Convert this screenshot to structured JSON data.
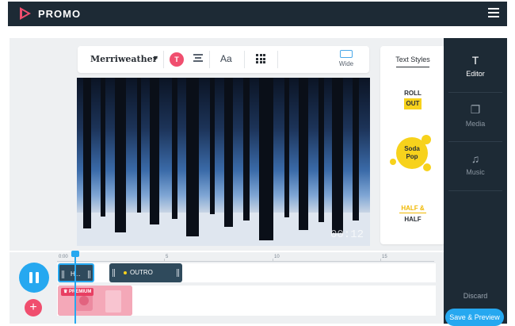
{
  "app": {
    "brand": "PROMO"
  },
  "toolbar": {
    "font_name": "Merriweather",
    "color_letter": "T",
    "size_label": "Aa",
    "wide_label": "Wide"
  },
  "video": {
    "timecode": "00:12"
  },
  "text_styles": {
    "title": "Text Styles",
    "style1_top": "ROLL",
    "style1_bottom": "OUT",
    "style2_top": "Soda",
    "style2_bottom": "Pop",
    "style3_top": "HALF &",
    "style3_bottom": "HALF"
  },
  "sidebar": {
    "items": [
      {
        "label": "Editor",
        "icon": "text-icon"
      },
      {
        "label": "Media",
        "icon": "media-icon"
      },
      {
        "label": "Music",
        "icon": "music-icon"
      }
    ],
    "discard": "Discard",
    "save": "Save & Preview"
  },
  "timeline": {
    "ticks": [
      "0:00",
      "5",
      "10",
      "15"
    ],
    "clip1_label": "H...",
    "clip2_label": "OUTRO",
    "premium_label": "PREMIUM",
    "playhead_time": "0:00"
  },
  "colors": {
    "accent_blue": "#26a8f0",
    "accent_pink": "#f04e6e",
    "dark_navy": "#1d2a35",
    "yellow": "#f7d21c"
  }
}
